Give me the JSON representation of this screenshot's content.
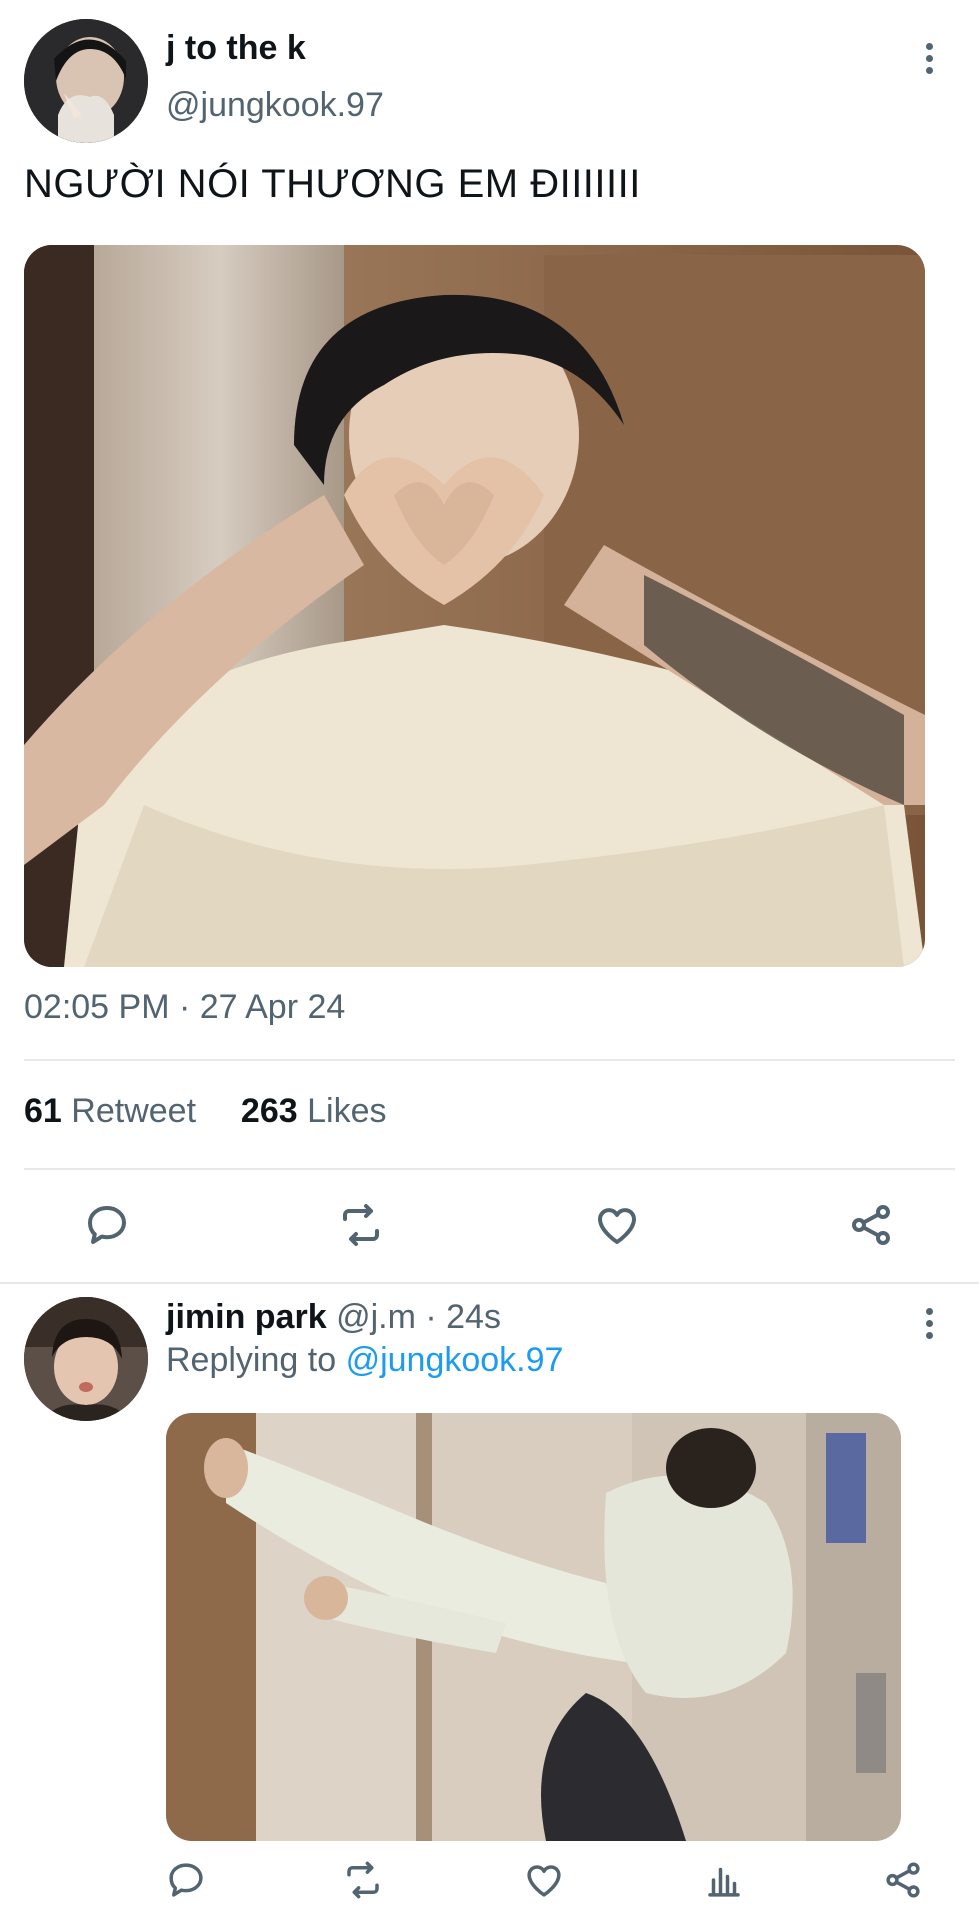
{
  "tweet": {
    "display_name": "j to the k",
    "handle": "@jungkook.97",
    "text": "NGƯỜI NÓI THƯƠNG EM ĐIIIIIII",
    "timestamp": "02:05 PM · 27 Apr 24",
    "retweet_count": "61",
    "retweet_label": "Retweet",
    "like_count": "263",
    "like_label": "Likes",
    "icons": [
      "reply-icon",
      "retweet-icon",
      "like-icon",
      "share-icon"
    ]
  },
  "reply": {
    "display_name": "jimin park",
    "handle": "@j.m",
    "time": "· 24s",
    "replying_prefix": "Replying to",
    "replying_handle": "@jungkook.97",
    "icons": [
      "reply-icon",
      "retweet-icon",
      "like-icon",
      "analytics-icon",
      "share-icon"
    ]
  },
  "colors": {
    "text": "#0f1419",
    "secondary": "#536471",
    "link": "#1d9bf0",
    "divider": "#e6e9ec"
  }
}
